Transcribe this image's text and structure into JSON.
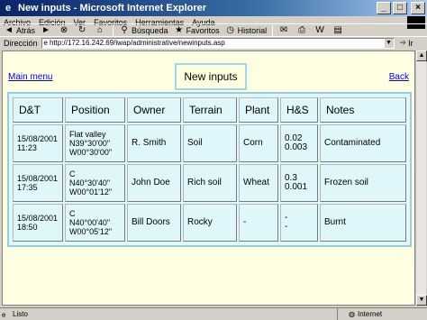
{
  "window": {
    "title": "New inputs - Microsoft Internet Explorer",
    "minimize_glyph": "_",
    "maximize_glyph": "□",
    "close_glyph": "×"
  },
  "menu": [
    "Archivo",
    "Edición",
    "Ver",
    "Favoritos",
    "Herramientas",
    "Ayuda"
  ],
  "toolbar": {
    "back": "Atrás",
    "search": "Búsqueda",
    "favorites": "Favoritos",
    "history": "Historial"
  },
  "address": {
    "label": "Dirección",
    "url": "http://172.16.242.69/iwap/administrative/newinputs.asp",
    "go": "Ir"
  },
  "page": {
    "main_menu": "Main menu",
    "heading": "New inputs",
    "back": "Back"
  },
  "table": {
    "headers": [
      "D&T",
      "Position",
      "Owner",
      "Terrain",
      "Plant",
      "H&S",
      "Notes"
    ],
    "rows": [
      {
        "dt": [
          "15/08/2001",
          "11:23"
        ],
        "position": [
          "Flat valley",
          "N39°30'00\"",
          "W00°30'00\""
        ],
        "owner": "R. Smith",
        "terrain": "Soil",
        "plant": "Corn",
        "hs": [
          "0.02",
          "0.003"
        ],
        "notes": "Contaminated"
      },
      {
        "dt": [
          "15/08/2001",
          "17:35"
        ],
        "position": [
          "C",
          "N40°30'40\"",
          "W00°01'12\""
        ],
        "owner": "John Doe",
        "terrain": "Rich soil",
        "plant": "Wheat",
        "hs": [
          "0.3",
          "0.001"
        ],
        "notes": "Frozen soil"
      },
      {
        "dt": [
          "15/08/2001",
          "18:50"
        ],
        "position": [
          "C",
          "N40°00'40\"",
          "W00°05'12\""
        ],
        "owner": "Bill Doors",
        "terrain": "Rocky",
        "plant": "-",
        "hs": [
          "-",
          "-"
        ],
        "notes": "Burnt"
      }
    ]
  },
  "status": {
    "text": "Listo",
    "zone": "Internet"
  }
}
